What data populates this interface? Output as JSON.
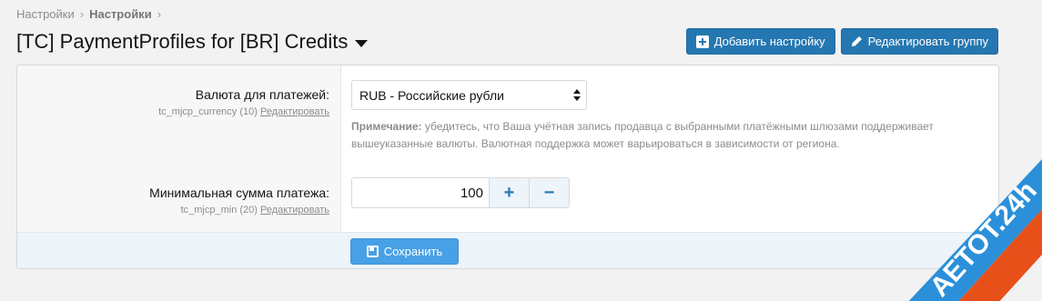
{
  "breadcrumb": {
    "items": [
      "Настройки",
      "Настройки"
    ]
  },
  "page": {
    "title": "[TC] PaymentProfiles for [BR] Credits"
  },
  "toolbar": {
    "add_setting_label": "Добавить настройку",
    "edit_group_label": "Редактировать группу"
  },
  "fields": {
    "currency": {
      "label": "Валюта для платежей:",
      "id_text": "tc_mjcp_currency (10)",
      "edit_link": "Редактировать",
      "selected": "RUB - Российские рубли",
      "note_bold": "Примечание:",
      "note_text": " убедитесь, что Ваша учётная запись продавца с выбранными платёжными шлюзами поддерживает вышеуказанные валюты. Валютная поддержка может варьироваться в зависимости от региона."
    },
    "min_amount": {
      "label": "Минимальная сумма платежа:",
      "id_text": "tc_mjcp_min (20)",
      "edit_link": "Редактировать",
      "value": "100",
      "plus": "+",
      "minus": "−"
    }
  },
  "footer": {
    "save_label": "Сохранить"
  },
  "watermark": {
    "text": "AETOT.24h"
  },
  "colors": {
    "primary": "#2577b1",
    "save": "#48a1e6",
    "footer_bg": "#edf4fa"
  }
}
